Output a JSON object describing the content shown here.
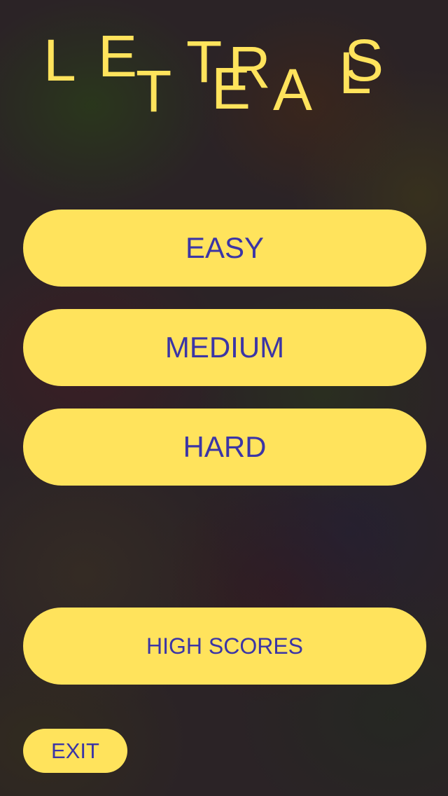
{
  "title": {
    "letters": [
      "L",
      "E",
      "T",
      "T",
      "E",
      "R",
      "A",
      "L",
      "S"
    ]
  },
  "menu": {
    "easy_label": "EASY",
    "medium_label": "MEDIUM",
    "hard_label": "HARD",
    "high_scores_label": "HIGH SCORES",
    "exit_label": "EXIT"
  },
  "colors": {
    "accent_yellow": "#ffe35c",
    "button_text": "#3b35a6",
    "background": "#2b2326"
  }
}
